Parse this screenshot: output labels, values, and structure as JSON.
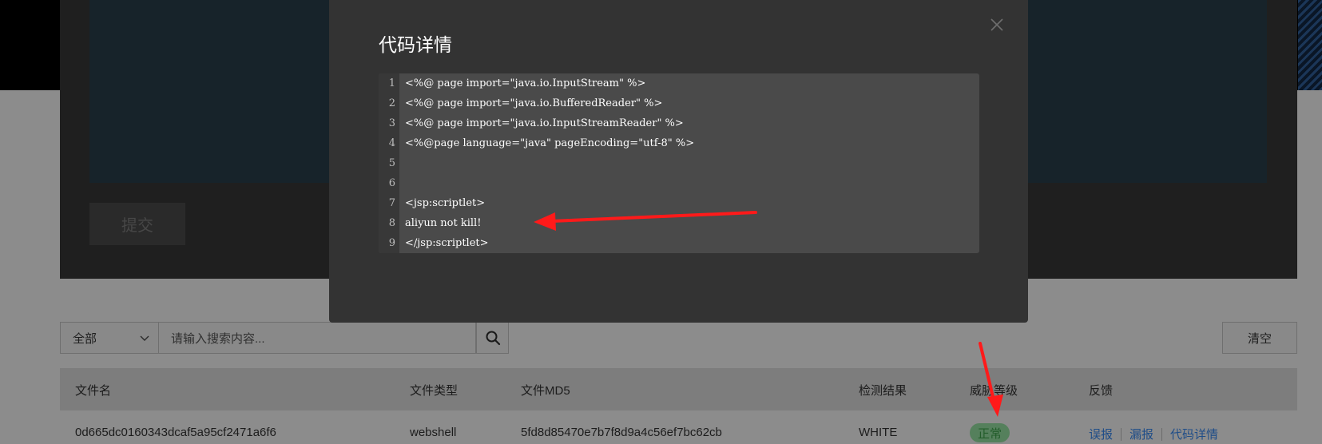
{
  "background": {
    "submit_label": "提交",
    "filter": {
      "selected": "全部"
    },
    "search": {
      "placeholder": "请输入搜索内容..."
    },
    "clear_label": "清空",
    "table": {
      "headers": [
        "文件名",
        "文件类型",
        "文件MD5",
        "检测结果",
        "威胁等级",
        "反馈"
      ],
      "rows": [
        {
          "filename": "0d665dc0160343dcaf5a95cf2471a6f6",
          "filetype": "webshell",
          "md5": "5fd8d85470e7b7f8d9a4c56ef7bc62cb",
          "result": "WHITE",
          "threat_level": "正常",
          "actions": [
            "误报",
            "漏报",
            "代码详情"
          ]
        }
      ]
    }
  },
  "modal": {
    "title": "代码详情",
    "code_lines": [
      {
        "num": "1",
        "text": "<%@ page import=\"java.io.InputStream\" %>"
      },
      {
        "num": "2",
        "text": "<%@ page import=\"java.io.BufferedReader\" %>"
      },
      {
        "num": "3",
        "text": "<%@ page import=\"java.io.InputStreamReader\" %>"
      },
      {
        "num": "4",
        "text": "<%@page language=\"java\" pageEncoding=\"utf-8\" %>"
      },
      {
        "num": "5",
        "text": ""
      },
      {
        "num": "6",
        "text": ""
      },
      {
        "num": "7",
        "text": "<jsp:scriptlet>"
      },
      {
        "num": "8",
        "text": "aliyun not kill!"
      },
      {
        "num": "9",
        "text": "</jsp:scriptlet>"
      }
    ]
  },
  "colors": {
    "annotation_arrow": "#ff1a1a",
    "badge_green": "#225c2a",
    "link_blue": "#1f4d88"
  }
}
